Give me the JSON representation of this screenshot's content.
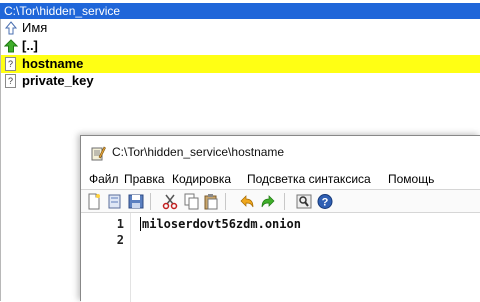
{
  "file_manager": {
    "path": "C:\\Tor\\hidden_service",
    "header_label": "Имя",
    "rows": [
      {
        "label": "[..]"
      },
      {
        "label": "hostname"
      },
      {
        "label": "private_key"
      }
    ],
    "doc_icon_glyph": "?"
  },
  "editor_window": {
    "title": "C:\\Tor\\hidden_service\\hostname",
    "menu": [
      "Файл",
      "Правка",
      "Кодировка",
      "Подсветка синтаксиса",
      "Помощь"
    ],
    "toolbar_icons": [
      "new-file-icon",
      "open-file-icon",
      "save-icon",
      "cut-icon",
      "copy-icon",
      "paste-icon",
      "undo-icon",
      "redo-icon",
      "find-icon",
      "help-icon"
    ],
    "lines": [
      {
        "number": "1",
        "text": "miloserdovt56zdm.onion"
      },
      {
        "number": "2",
        "text": ""
      }
    ]
  },
  "colors": {
    "path_bar": "#1f66d9",
    "selection": "#ffff14"
  }
}
